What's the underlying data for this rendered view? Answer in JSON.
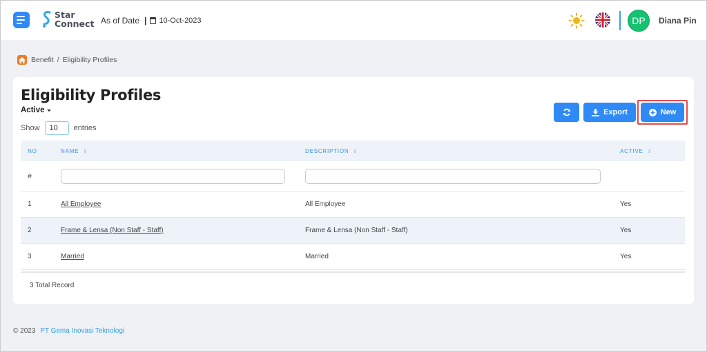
{
  "header": {
    "logo_line1": "Star",
    "logo_line2": "Connect",
    "as_of_label": "As of Date",
    "as_of_date": "10-Oct-2023",
    "avatar_initials": "DP",
    "user_name": "Diana Pin"
  },
  "breadcrumb": {
    "items": [
      "Benefit",
      "Eligibility Profiles"
    ]
  },
  "page": {
    "title": "Eligibility Profiles",
    "status_filter": "Active",
    "show_label": "Show",
    "entries_value": "10",
    "entries_label": "entries"
  },
  "toolbar": {
    "export_label": "Export",
    "new_label": "New"
  },
  "table": {
    "columns": [
      "NO",
      "NAME",
      "DESCRIPTION",
      "ACTIVE"
    ],
    "filter_row_label": "#",
    "rows": [
      {
        "no": "1",
        "name": "All Employee",
        "description": "All Employee",
        "active": "Yes"
      },
      {
        "no": "2",
        "name": "Frame & Lensa (Non Staff - Staff)",
        "description": "Frame & Lensa (Non Staff - Staff)",
        "active": "Yes"
      },
      {
        "no": "3",
        "name": "Married",
        "description": "Married",
        "active": "Yes"
      }
    ],
    "total_text": "3 Total Record"
  },
  "footer": {
    "copyright": "© 2023",
    "company": "PT Gema Inovasi Teknologi"
  },
  "colors": {
    "primary": "#2f8af5",
    "avatar": "#16c172",
    "home_icon": "#f07b26",
    "highlight_border": "#e04c4c"
  }
}
